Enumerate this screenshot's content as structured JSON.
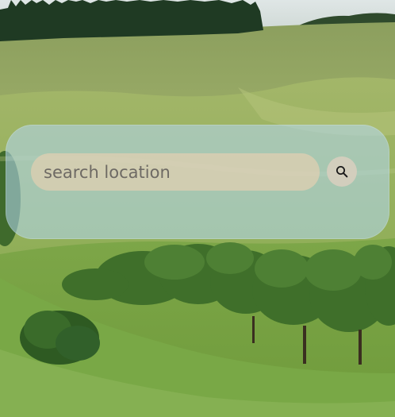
{
  "search": {
    "placeholder": "search location",
    "value": "",
    "button_icon": "search-icon"
  },
  "background": {
    "description_icon": "landscape-background"
  },
  "colors": {
    "card_tint": "#b2d6ec",
    "input_bg": "#e2d0b2",
    "button_bg": "#d6cebe",
    "icon": "#1a1a1a"
  }
}
